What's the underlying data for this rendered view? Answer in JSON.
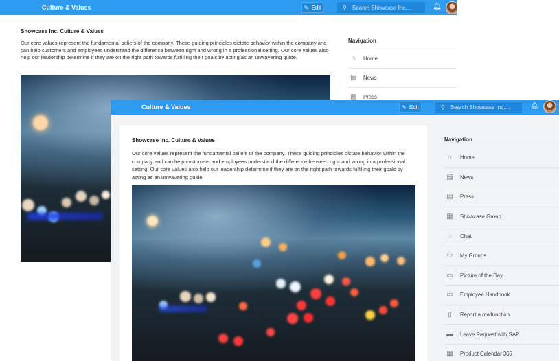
{
  "app": {
    "title": "Culture & Values",
    "edit_label": "Edit",
    "search_placeholder": "Search Showcase Inc...."
  },
  "page": {
    "heading": "Showcase Inc. Culture & Values",
    "intro": "Our core values represent the fundamental beliefs of the company. These guiding principles dictate behavior within the company and can help customers and employees understand the difference between right and wrong in a professional setting. Our core values also help our leadership determine if they are on the right path towards fulfilling their goals by acting as an unwavering guide."
  },
  "navigation": {
    "heading": "Navigation",
    "items": [
      {
        "label": "Home",
        "icon": "home-icon"
      },
      {
        "label": "News",
        "icon": "news-icon"
      },
      {
        "label": "Press",
        "icon": "press-icon"
      },
      {
        "label": "Showcase Group",
        "icon": "building-icon"
      },
      {
        "label": "Chat",
        "icon": "chat-icon"
      },
      {
        "label": "My Groups",
        "icon": "groups-icon"
      },
      {
        "label": "Picture of the Day",
        "icon": "folder-icon"
      },
      {
        "label": "Employee Handbook",
        "icon": "folder-icon"
      },
      {
        "label": "Report a malfunction",
        "icon": "clipboard-icon"
      },
      {
        "label": "Leave Request with SAP",
        "icon": "card-icon"
      },
      {
        "label": "Product Calendar 365",
        "icon": "calendar-icon"
      }
    ]
  },
  "colors": {
    "topbar": "#2f9bf0",
    "page_background": "#f2f3f5"
  }
}
